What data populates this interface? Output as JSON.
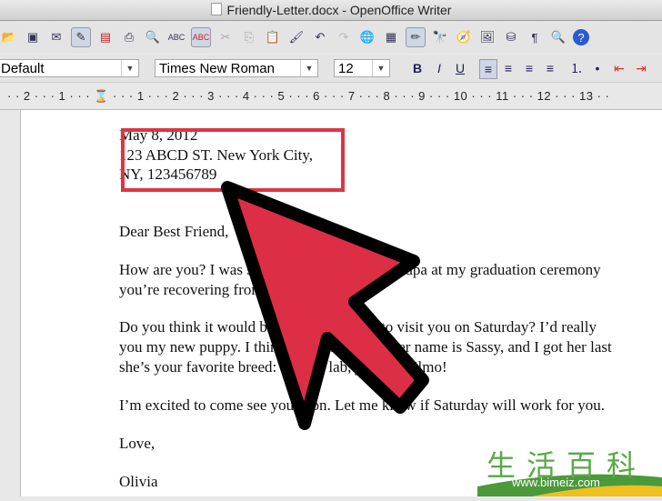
{
  "window": {
    "title": "Friendly-Letter.docx - OpenOffice Writer"
  },
  "toolbar": {
    "icons": [
      "open-icon",
      "save-icon",
      "email-icon",
      "edit-mode-icon",
      "export-pdf-icon",
      "print-icon",
      "print-preview-icon",
      "spellcheck-icon",
      "autospellcheck-icon",
      "cut-icon",
      "copy-icon",
      "paste-icon",
      "clone-format-icon",
      "undo-icon",
      "redo-icon",
      "hyperlink-icon",
      "table-icon",
      "draw-icon",
      "find-icon",
      "navigator-icon",
      "gallery-icon",
      "data-sources-icon",
      "formatting-marks-icon",
      "zoom-icon",
      "help-icon"
    ]
  },
  "format": {
    "style": "Default",
    "font": "Times New Roman",
    "size": "12",
    "bold": "B",
    "italic": "I",
    "underline": "U"
  },
  "ruler": {
    "text": "· · 2 · · · 1 · · · ⌛ · · · 1 · · · 2 · · · 3 · · · 4 · · · 5 · · · 6 · · · 7 · · · 8 · · · 9 · · · 10 · · · 11 · · · 12 · · · 13 · ·"
  },
  "document": {
    "lines": [
      "May 8, 2012",
      "123 ABCD ST. New York City,",
      "NY, 123456789",
      "Dear Best Friend,",
      "How are you? I was so happy to see your grandpa at my graduation ceremony",
      "you’re recovering from",
      "Do you think it would be alright if I came to visit you on Saturday? I’d really",
      "you my new puppy. I think you’ll love her. Her name is Sassy, and I got her last",
      "she’s your favorite breed: a black lab, just like Elmo!",
      "I’m excited to come see you soon. Let me know if Saturday will work for you.",
      "Love,",
      "Olivia"
    ]
  },
  "annotation": {
    "highlight_color": "#dc3545",
    "arrow_color": "#dc3545"
  },
  "watermark": {
    "text": "生活百科",
    "url": "www.bimeiz.com"
  }
}
